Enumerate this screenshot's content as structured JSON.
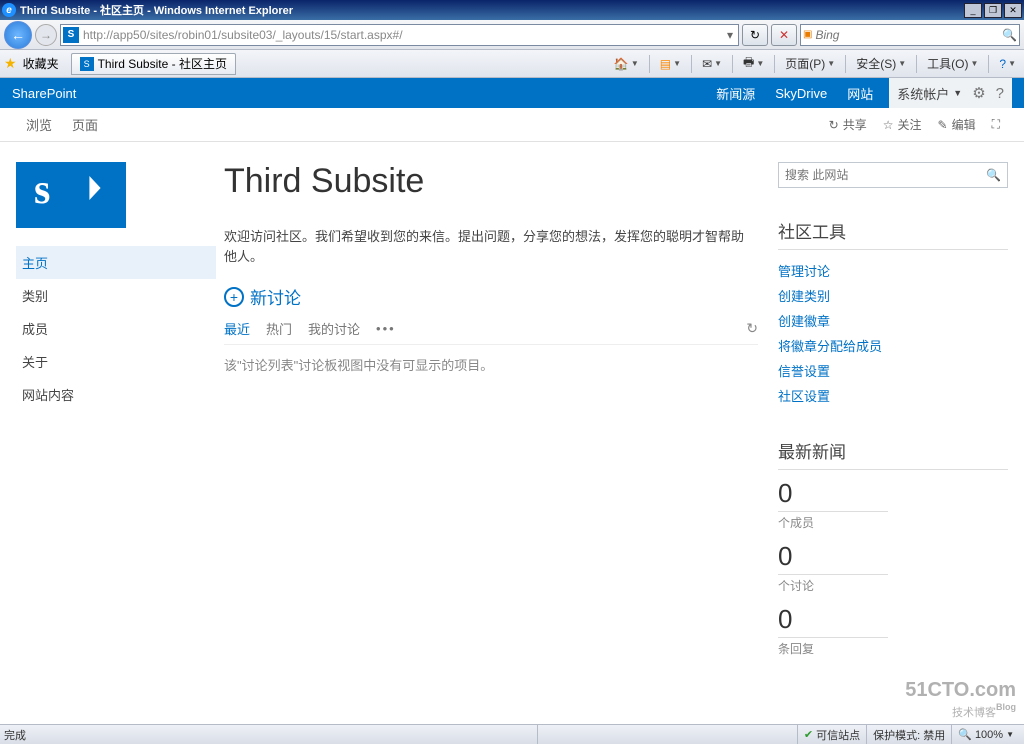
{
  "window": {
    "title": "Third Subsite - 社区主页 - Windows Internet Explorer"
  },
  "nav": {
    "url": "http://app50/sites/robin01/subsite03/_layouts/15/start.aspx#/",
    "search_placeholder": "Bing"
  },
  "favbar": {
    "favorites": "收藏夹",
    "tab_title": "Third Subsite - 社区主页",
    "tools": {
      "page": "页面(P)",
      "safety": "安全(S)",
      "tools": "工具(O)"
    }
  },
  "suitebar": {
    "brand": "SharePoint",
    "links": [
      "新闻源",
      "SkyDrive",
      "网站"
    ],
    "account": "系统帐户"
  },
  "ribbon": {
    "tabs": [
      "浏览",
      "页面"
    ],
    "actions": {
      "share": "共享",
      "follow": "关注",
      "edit": "编辑"
    }
  },
  "sidenav": [
    "主页",
    "类别",
    "成员",
    "关于",
    "网站内容"
  ],
  "page": {
    "title": "Third Subsite",
    "welcome": "欢迎访问社区。我们希望收到您的来信。提出问题，分享您的想法，发挥您的聪明才智帮助他人。",
    "new_discussion": "新讨论",
    "filters": [
      "最近",
      "热门",
      "我的讨论"
    ],
    "empty": "该\"讨论列表\"讨论板视图中没有可显示的项目。"
  },
  "search": {
    "placeholder": "搜索 此网站"
  },
  "community_tools": {
    "title": "社区工具",
    "links": [
      "管理讨论",
      "创建类别",
      "创建徽章",
      "将徽章分配给成员",
      "信誉设置",
      "社区设置"
    ]
  },
  "news": {
    "title": "最新新闻",
    "stats": [
      {
        "num": "0",
        "label": "个成员"
      },
      {
        "num": "0",
        "label": "个讨论"
      },
      {
        "num": "0",
        "label": "条回复"
      }
    ]
  },
  "statusbar": {
    "done": "完成",
    "trusted": "可信站点",
    "protected": "保护模式: 禁用",
    "zoom": "100%"
  },
  "watermark": {
    "main": "51CTO.com",
    "sub": "技术博客",
    "blog": "Blog"
  }
}
